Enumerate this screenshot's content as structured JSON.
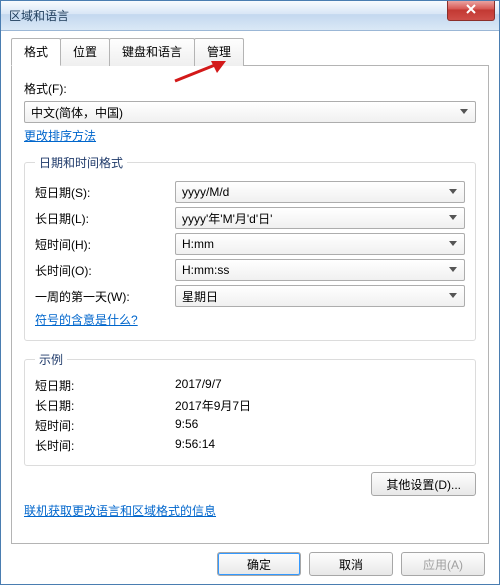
{
  "window": {
    "title": "区域和语言"
  },
  "tabs": {
    "format": "格式",
    "location": "位置",
    "keyboard": "键盘和语言",
    "admin": "管理"
  },
  "format": {
    "label": "格式(F):",
    "value": "中文(简体，中国)",
    "change_sort_link": "更改排序方法"
  },
  "datetime": {
    "legend": "日期和时间格式",
    "short_date_label": "短日期(S):",
    "short_date_value": "yyyy/M/d",
    "long_date_label": "长日期(L):",
    "long_date_value": "yyyy'年'M'月'd'日'",
    "short_time_label": "短时间(H):",
    "short_time_value": "H:mm",
    "long_time_label": "长时间(O):",
    "long_time_value": "H:mm:ss",
    "first_day_label": "一周的第一天(W):",
    "first_day_value": "星期日",
    "symbols_link": "符号的含意是什么?"
  },
  "example": {
    "legend": "示例",
    "short_date_label": "短日期:",
    "short_date_value": "2017/9/7",
    "long_date_label": "长日期:",
    "long_date_value": "2017年9月7日",
    "short_time_label": "短时间:",
    "short_time_value": "9:56",
    "long_time_label": "长时间:",
    "long_time_value": "9:56:14"
  },
  "buttons": {
    "other_settings": "其他设置(D)...",
    "ok": "确定",
    "cancel": "取消",
    "apply": "应用(A)"
  },
  "online_link": "联机获取更改语言和区域格式的信息"
}
